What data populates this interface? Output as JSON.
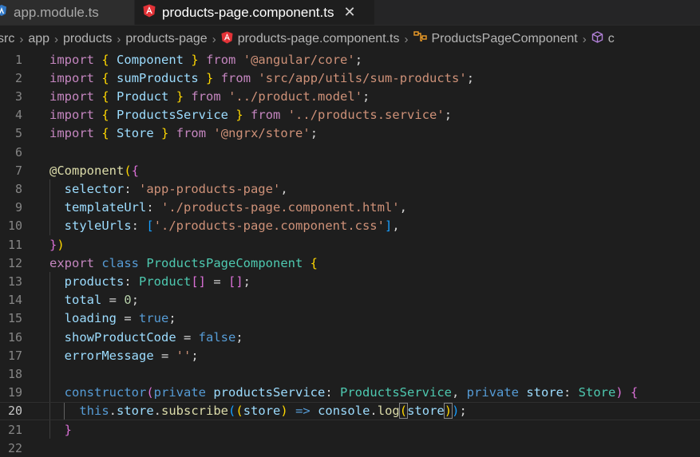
{
  "tabs": [
    {
      "label": "app.module.ts",
      "active": false
    },
    {
      "label": "products-page.component.ts",
      "active": true
    }
  ],
  "breadcrumb": [
    "src",
    "app",
    "products",
    "products-page",
    "products-page.component.ts",
    "ProductsPageComponent",
    "c"
  ],
  "editor": {
    "current_line": 20,
    "lines": [
      {
        "n": "1",
        "tokens": [
          [
            "kw",
            "import"
          ],
          [
            "pl",
            " "
          ],
          [
            "p1",
            "{"
          ],
          [
            "pl",
            " "
          ],
          [
            "vr",
            "Component"
          ],
          [
            "pl",
            " "
          ],
          [
            "p1",
            "}"
          ],
          [
            "pl",
            " "
          ],
          [
            "kw",
            "from"
          ],
          [
            "pl",
            " "
          ],
          [
            "st",
            "'@angular/core'"
          ],
          [
            "pl",
            ";"
          ]
        ]
      },
      {
        "n": "2",
        "tokens": [
          [
            "kw",
            "import"
          ],
          [
            "pl",
            " "
          ],
          [
            "p1",
            "{"
          ],
          [
            "pl",
            " "
          ],
          [
            "vr",
            "sumProducts"
          ],
          [
            "pl",
            " "
          ],
          [
            "p1",
            "}"
          ],
          [
            "pl",
            " "
          ],
          [
            "kw",
            "from"
          ],
          [
            "pl",
            " "
          ],
          [
            "st",
            "'src/app/utils/sum-products'"
          ],
          [
            "pl",
            ";"
          ]
        ]
      },
      {
        "n": "3",
        "tokens": [
          [
            "kw",
            "import"
          ],
          [
            "pl",
            " "
          ],
          [
            "p1",
            "{"
          ],
          [
            "pl",
            " "
          ],
          [
            "vr",
            "Product"
          ],
          [
            "pl",
            " "
          ],
          [
            "p1",
            "}"
          ],
          [
            "pl",
            " "
          ],
          [
            "kw",
            "from"
          ],
          [
            "pl",
            " "
          ],
          [
            "st",
            "'../product.model'"
          ],
          [
            "pl",
            ";"
          ]
        ]
      },
      {
        "n": "4",
        "tokens": [
          [
            "kw",
            "import"
          ],
          [
            "pl",
            " "
          ],
          [
            "p1",
            "{"
          ],
          [
            "pl",
            " "
          ],
          [
            "vr",
            "ProductsService"
          ],
          [
            "pl",
            " "
          ],
          [
            "p1",
            "}"
          ],
          [
            "pl",
            " "
          ],
          [
            "kw",
            "from"
          ],
          [
            "pl",
            " "
          ],
          [
            "st",
            "'../products.service'"
          ],
          [
            "pl",
            ";"
          ]
        ]
      },
      {
        "n": "5",
        "tokens": [
          [
            "kw",
            "import"
          ],
          [
            "pl",
            " "
          ],
          [
            "p1",
            "{"
          ],
          [
            "pl",
            " "
          ],
          [
            "vr",
            "Store"
          ],
          [
            "pl",
            " "
          ],
          [
            "p1",
            "}"
          ],
          [
            "pl",
            " "
          ],
          [
            "kw",
            "from"
          ],
          [
            "pl",
            " "
          ],
          [
            "st",
            "'@ngrx/store'"
          ],
          [
            "pl",
            ";"
          ]
        ]
      },
      {
        "n": "6",
        "tokens": []
      },
      {
        "n": "7",
        "tokens": [
          [
            "fn",
            "@"
          ],
          [
            "fn",
            "Component"
          ],
          [
            "p1",
            "("
          ],
          [
            "p2",
            "{"
          ]
        ]
      },
      {
        "n": "8",
        "tokens": [
          [
            "pl",
            "  "
          ],
          [
            "vr",
            "selector"
          ],
          [
            "pl",
            ": "
          ],
          [
            "st",
            "'app-products-page'"
          ],
          [
            "pl",
            ","
          ]
        ]
      },
      {
        "n": "9",
        "tokens": [
          [
            "pl",
            "  "
          ],
          [
            "vr",
            "templateUrl"
          ],
          [
            "pl",
            ": "
          ],
          [
            "st",
            "'./products-page.component.html'"
          ],
          [
            "pl",
            ","
          ]
        ]
      },
      {
        "n": "10",
        "tokens": [
          [
            "pl",
            "  "
          ],
          [
            "vr",
            "styleUrls"
          ],
          [
            "pl",
            ": "
          ],
          [
            "p3",
            "["
          ],
          [
            "st",
            "'./products-page.component.css'"
          ],
          [
            "p3",
            "]"
          ],
          [
            "pl",
            ","
          ]
        ]
      },
      {
        "n": "11",
        "tokens": [
          [
            "p2",
            "}"
          ],
          [
            "p1",
            ")"
          ]
        ]
      },
      {
        "n": "12",
        "tokens": [
          [
            "kw",
            "export"
          ],
          [
            "pl",
            " "
          ],
          [
            "bl",
            "class"
          ],
          [
            "pl",
            " "
          ],
          [
            "ty",
            "ProductsPageComponent"
          ],
          [
            "pl",
            " "
          ],
          [
            "p1",
            "{"
          ]
        ]
      },
      {
        "n": "13",
        "tokens": [
          [
            "pl",
            "  "
          ],
          [
            "vr",
            "products"
          ],
          [
            "pl",
            ": "
          ],
          [
            "ty",
            "Product"
          ],
          [
            "p2",
            "[]"
          ],
          [
            "pl",
            " = "
          ],
          [
            "p2",
            "[]"
          ],
          [
            "pl",
            ";"
          ]
        ]
      },
      {
        "n": "14",
        "tokens": [
          [
            "pl",
            "  "
          ],
          [
            "vr",
            "total"
          ],
          [
            "pl",
            " = "
          ],
          [
            "nm",
            "0"
          ],
          [
            "pl",
            ";"
          ]
        ]
      },
      {
        "n": "15",
        "tokens": [
          [
            "pl",
            "  "
          ],
          [
            "vr",
            "loading"
          ],
          [
            "pl",
            " = "
          ],
          [
            "bl",
            "true"
          ],
          [
            "pl",
            ";"
          ]
        ]
      },
      {
        "n": "16",
        "tokens": [
          [
            "pl",
            "  "
          ],
          [
            "vr",
            "showProductCode"
          ],
          [
            "pl",
            " = "
          ],
          [
            "bl",
            "false"
          ],
          [
            "pl",
            ";"
          ]
        ]
      },
      {
        "n": "17",
        "tokens": [
          [
            "pl",
            "  "
          ],
          [
            "vr",
            "errorMessage"
          ],
          [
            "pl",
            " = "
          ],
          [
            "st",
            "''"
          ],
          [
            "pl",
            ";"
          ]
        ]
      },
      {
        "n": "18",
        "tokens": []
      },
      {
        "n": "19",
        "tokens": [
          [
            "pl",
            "  "
          ],
          [
            "bl",
            "constructor"
          ],
          [
            "p2",
            "("
          ],
          [
            "bl",
            "private"
          ],
          [
            "pl",
            " "
          ],
          [
            "vr",
            "productsService"
          ],
          [
            "pl",
            ": "
          ],
          [
            "ty",
            "ProductsService"
          ],
          [
            "pl",
            ", "
          ],
          [
            "bl",
            "private"
          ],
          [
            "pl",
            " "
          ],
          [
            "vr",
            "store"
          ],
          [
            "pl",
            ": "
          ],
          [
            "ty",
            "Store"
          ],
          [
            "p2",
            ")"
          ],
          [
            "pl",
            " "
          ],
          [
            "p2",
            "{"
          ]
        ]
      },
      {
        "n": "20",
        "tokens": [
          [
            "pl",
            "    "
          ],
          [
            "bl",
            "this"
          ],
          [
            "pl",
            "."
          ],
          [
            "vr",
            "store"
          ],
          [
            "pl",
            "."
          ],
          [
            "fn",
            "subscribe"
          ],
          [
            "p3",
            "("
          ],
          [
            "p1",
            "("
          ],
          [
            "vr",
            "store"
          ],
          [
            "p1",
            ")"
          ],
          [
            "pl",
            " "
          ],
          [
            "bl",
            "=>"
          ],
          [
            "pl",
            " "
          ],
          [
            "vr",
            "console"
          ],
          [
            "pl",
            "."
          ],
          [
            "fn",
            "log"
          ],
          [
            "p1",
            "("
          ],
          [
            "vr",
            "store"
          ],
          [
            "p1",
            ")"
          ],
          [
            "p3",
            ")"
          ],
          [
            "pl",
            ";"
          ]
        ]
      },
      {
        "n": "21",
        "tokens": [
          [
            "pl",
            "  "
          ],
          [
            "p2",
            "}"
          ]
        ]
      },
      {
        "n": "22",
        "tokens": []
      }
    ]
  },
  "icons": {
    "ts_file": "typescript-file-icon",
    "angular": "angular-icon",
    "class_symbol": "class-symbol-icon",
    "cube_symbol": "cube-symbol-icon"
  },
  "colors": {
    "editor_bg": "#1e1e1e",
    "angular_red": "#e23237",
    "ts_blue": "#3178c6",
    "class_orange": "#ee9d28",
    "cube_purple": "#b180d7"
  }
}
